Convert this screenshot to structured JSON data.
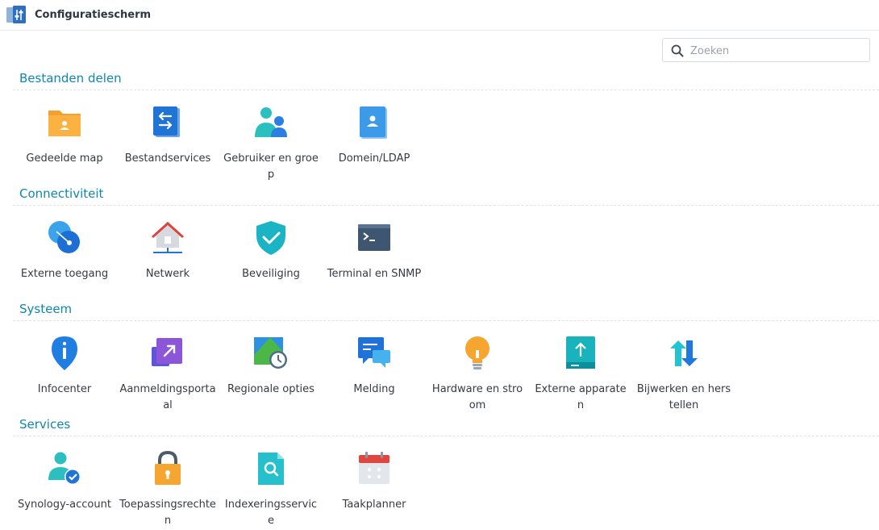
{
  "window": {
    "title": "Configuratiescherm"
  },
  "search": {
    "placeholder": "Zoeken"
  },
  "sections": [
    {
      "title": "Bestanden delen",
      "items": [
        "Gedeelde map",
        "Bestandservices",
        "Gebruiker en groep",
        "Domein/LDAP"
      ]
    },
    {
      "title": "Connectiviteit",
      "items": [
        "Externe toegang",
        "Netwerk",
        "Beveiliging",
        "Terminal en SNMP"
      ]
    },
    {
      "title": "Systeem",
      "items": [
        "Infocenter",
        "Aanmeldingsportaal",
        "Regionale opties",
        "Melding",
        "Hardware en stroom",
        "Externe apparaten",
        "Bijwerken en herstellen"
      ]
    },
    {
      "title": "Services",
      "items": [
        "Synology-account",
        "Toepassingsrechten",
        "Indexeringsservice",
        "Taakplanner"
      ]
    }
  ],
  "icons": {
    "shared-folder": "folder-icon",
    "file-services": "file-transfer-icon",
    "user-group": "users-icon",
    "domain": "domain-icon",
    "external-access": "globe-icon",
    "network": "house-network-icon",
    "security": "shield-icon",
    "terminal": "terminal-icon",
    "info": "info-pin-icon",
    "login-portal": "portal-arrow-icon",
    "regional": "map-clock-icon",
    "notification": "chat-bubble-icon",
    "hardware": "lightbulb-icon",
    "external-devices": "upload-drive-icon",
    "update": "refresh-arrows-icon",
    "account": "user-check-icon",
    "privileges": "lock-icon",
    "indexing": "search-file-icon",
    "scheduler": "calendar-icon"
  },
  "colors": {
    "section_title": "#0f86b4",
    "accent_blue": "#2a8fe0"
  }
}
